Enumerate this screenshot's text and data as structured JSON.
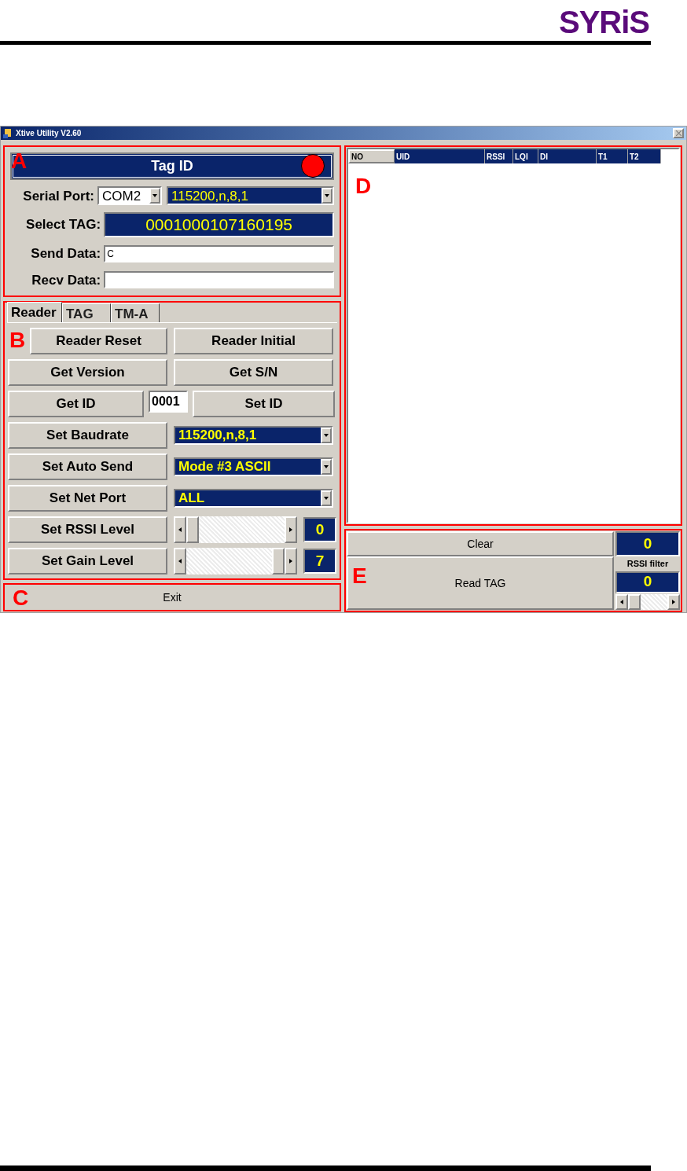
{
  "logo": {
    "text": "SYRiS"
  },
  "window": {
    "title": "Xtive Utility V2.60"
  },
  "tag_panel": {
    "annotation": "A",
    "tag_id_label": "Tag ID",
    "indicator": {
      "on": true
    },
    "serial_port": {
      "label": "Serial Port:",
      "port": "COM2",
      "settings": "115200,n,8,1"
    },
    "select_tag": {
      "label": "Select TAG:",
      "value": "0001000107160195"
    },
    "send_data": {
      "label": "Send Data:",
      "value": "C"
    },
    "recv_data": {
      "label": "Recv Data:"
    }
  },
  "reader_panel": {
    "annotation": "B",
    "tabs": [
      {
        "label": "Reader",
        "selected": true
      },
      {
        "label": "TAG",
        "selected": false
      },
      {
        "label": "TM-A",
        "selected": false
      }
    ],
    "rows": [
      {
        "kind": "pair",
        "left": "Reader Reset",
        "right": "Reader Initial"
      },
      {
        "kind": "pair",
        "left": "Get Version",
        "right": "Get S/N"
      },
      {
        "kind": "id",
        "left": "Get ID",
        "value": "0001",
        "right": "Set ID"
      },
      {
        "kind": "select",
        "button": "Set Baudrate",
        "value": "115200,n,8,1"
      },
      {
        "kind": "select",
        "button": "Set Auto Send",
        "value": "Mode #3 ASCII"
      },
      {
        "kind": "select",
        "button": "Set Net Port",
        "value": "ALL"
      },
      {
        "kind": "slider",
        "button": "Set RSSI Level",
        "level": 0,
        "reading": "0"
      },
      {
        "kind": "slider",
        "button": "Set Gain Level",
        "level": 1,
        "reading": "7"
      }
    ]
  },
  "exit_panel": {
    "annotation": "C",
    "button": "Exit"
  },
  "results_panel": {
    "annotation": "D",
    "table": {
      "columns": [
        "NO",
        "UID",
        "RSSI",
        "LQI",
        "DI",
        "T1",
        "T2"
      ]
    }
  },
  "read_panel": {
    "annotation": "E",
    "clear_button": "Clear",
    "count": "0",
    "read_button": "Read TAG",
    "rssi_filter": {
      "label": "RSSI filter",
      "reading": "0",
      "level": 0
    }
  }
}
